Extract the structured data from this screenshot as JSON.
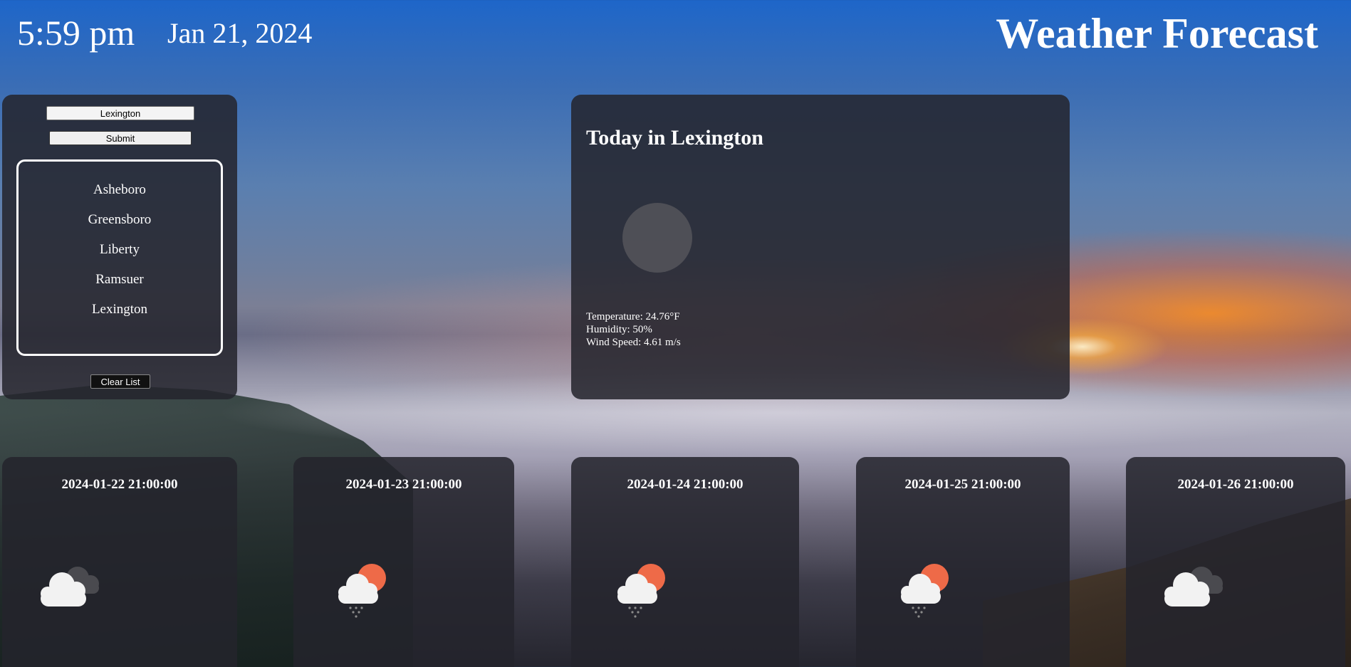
{
  "header": {
    "time": "5:59 pm",
    "date": "Jan 21, 2024",
    "title": "Weather Forecast"
  },
  "search": {
    "input_value": "Lexington",
    "submit_label": "Submit",
    "history": [
      "Asheboro",
      "Greensboro",
      "Liberty",
      "Ramsuer",
      "Lexington"
    ],
    "clear_label": "Clear List"
  },
  "today": {
    "title": "Today in Lexington",
    "icon": "placeholder-circle-icon",
    "temperature": "Temperature: 24.76°F",
    "humidity": "Humidity: 50%",
    "wind": "Wind Speed: 4.61 m/s"
  },
  "forecast": [
    {
      "date": "2024-01-22 21:00:00",
      "icon": "overcast-clouds-icon"
    },
    {
      "date": "2024-01-23 21:00:00",
      "icon": "rain-sun-cloud-icon"
    },
    {
      "date": "2024-01-24 21:00:00",
      "icon": "rain-sun-cloud-icon"
    },
    {
      "date": "2024-01-25 21:00:00",
      "icon": "rain-sun-cloud-icon"
    },
    {
      "date": "2024-01-26 21:00:00",
      "icon": "overcast-clouds-icon"
    }
  ],
  "colors": {
    "panel": "#24242c",
    "sun": "#ee6a48",
    "cloud_light": "#f2f2f2",
    "cloud_dark": "#4a4a4f"
  }
}
